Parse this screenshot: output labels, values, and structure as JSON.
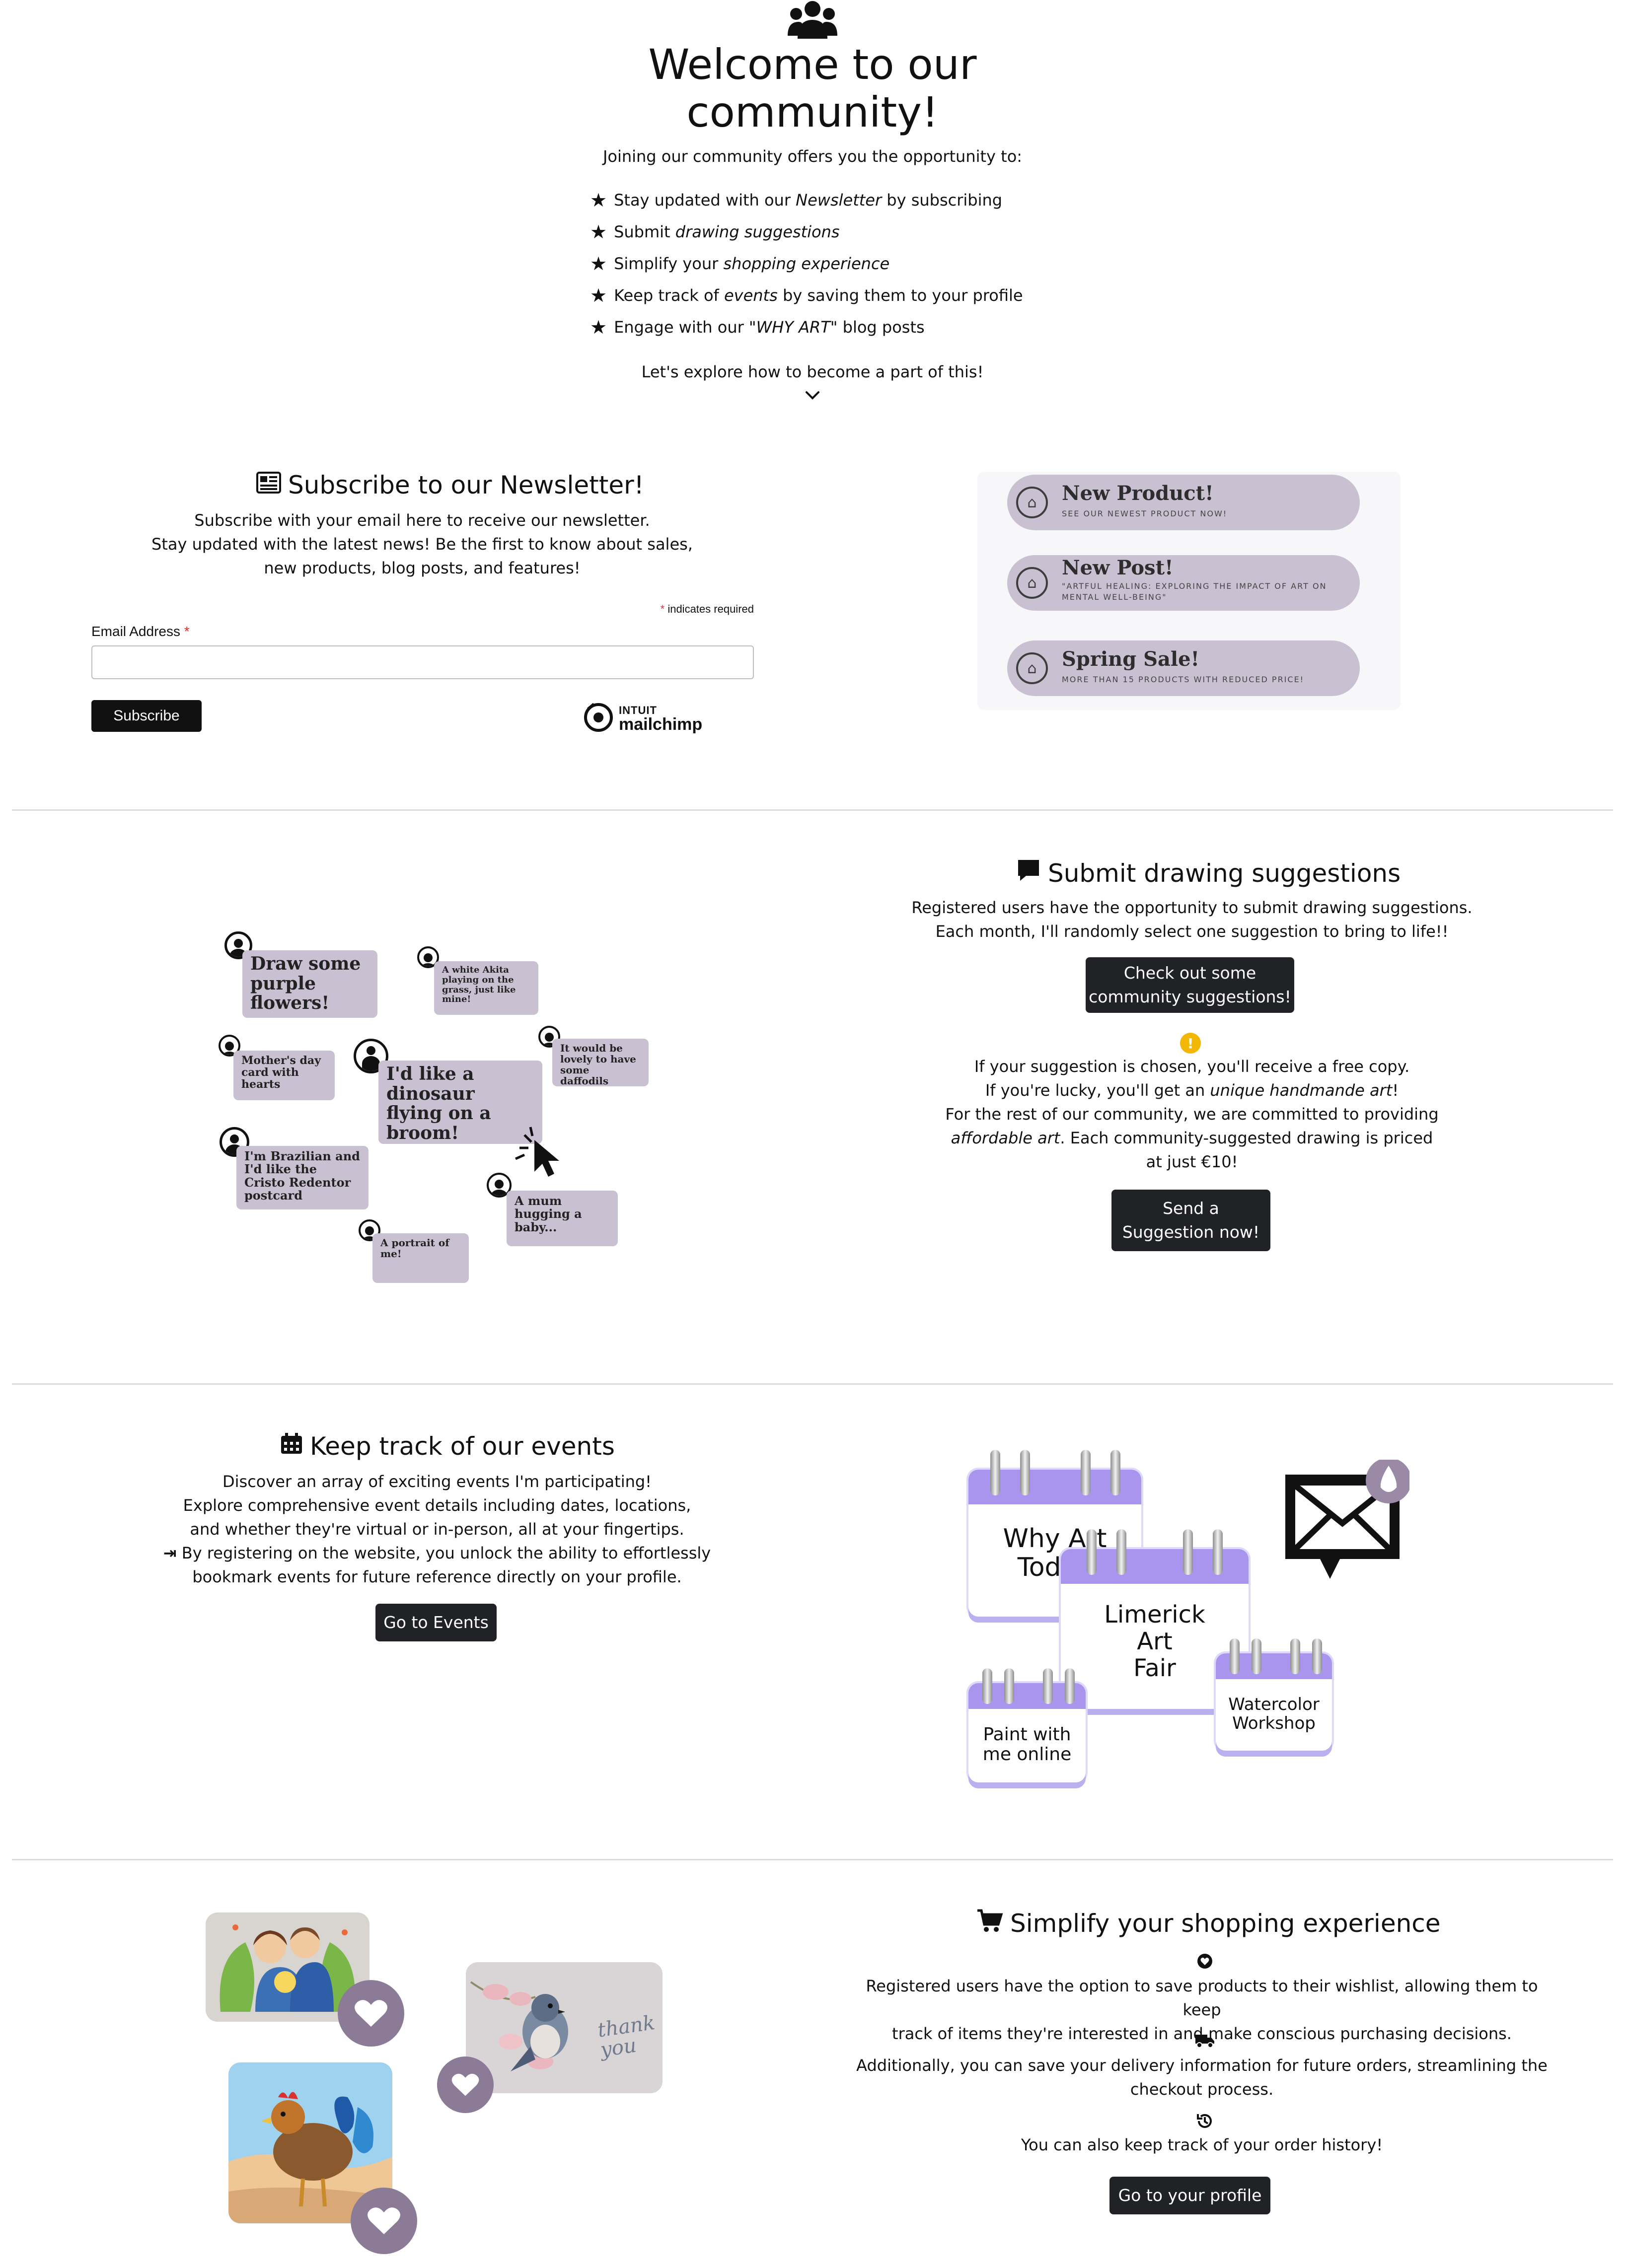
{
  "hero": {
    "icon": "users-icon",
    "title_line1": "Welcome to our",
    "title_line2": "community!",
    "subtitle": "Joining our community offers you the opportunity to:",
    "benefits": [
      {
        "pre": "Stay updated with our ",
        "em": "Newsletter",
        "post": " by subscribing"
      },
      {
        "pre": "Submit ",
        "em": "drawing suggestions",
        "post": ""
      },
      {
        "pre": "Simplify your ",
        "em": "shopping experience",
        "post": ""
      },
      {
        "pre": "Keep track of ",
        "em": "events",
        "post": " by saving them to your profile"
      },
      {
        "pre": "Engage with our ",
        "em": "\"WHY ART\"",
        "post": " blog posts"
      }
    ],
    "explore": "Let's explore how to become a part of this!"
  },
  "newsletter": {
    "title": "Subscribe to our Newsletter!",
    "line1": "Subscribe with your email here to receive our newsletter.",
    "line2": "Stay updated with the latest news! Be the first to know about sales,",
    "line3": "new products, blog posts, and features!",
    "required_note": "indicates required",
    "email_label": "Email Address",
    "subscribe_label": "Subscribe",
    "mailchimp_top": "INTUIT",
    "mailchimp_bottom": "mailchimp",
    "notifications": [
      {
        "title": "New Product!",
        "sub": "SEE OUR NEWEST PRODUCT NOW!"
      },
      {
        "title": "New Post!",
        "sub": "\"ARTFUL HEALING: EXPLORING THE IMPACT OF ART ON MENTAL WELL-BEING\""
      },
      {
        "title": "Spring Sale!",
        "sub": "MORE THAN 15 PRODUCTS WITH REDUCED PRICE!"
      }
    ]
  },
  "suggestions": {
    "title": "Submit drawing suggestions",
    "line1": "Registered users have the opportunity to submit drawing suggestions.",
    "line2": "Each month, I'll randomly select one suggestion to bring to life!!",
    "check_btn_line1": "Check out some",
    "check_btn_line2": "community suggestions!",
    "info1": "If your suggestion is chosen, you'll receive a free copy.",
    "info2_pre": "If you're lucky, you'll get an ",
    "info2_em": "unique handmande art",
    "info2_post": "!",
    "info3": "For the rest of our community, we are committed to providing",
    "info4_em": "affordable art",
    "info4_post": ". Each community-suggested drawing is priced",
    "info5": "at just €10!",
    "send_btn_line1": "Send a",
    "send_btn_line2": "Suggestion now!",
    "bubbles": [
      "Draw some purple flowers!",
      "A white Akita playing on the grass, just like mine!",
      "Mother's day card with hearts",
      "I'd like a dinosaur flying on a broom!",
      "It would be lovely to have some daffodils",
      "I'm Brazilian and I'd like the Cristo Redentor postcard",
      "A mum hugging a baby...",
      "A portrait of me!"
    ]
  },
  "events": {
    "title": "Keep track of our events",
    "line1": "Discover an array of exciting events I'm participating!",
    "line2": "Explore comprehensive event details including dates, locations,",
    "line3": "and whether they're virtual or in-person, all at your fingertips.",
    "line4": "By registering on the website, you unlock the ability to effortlessly",
    "line5": "bookmark events for future reference directly on your profile.",
    "button": "Go to Events",
    "calendars": {
      "why_line1": "Why Art",
      "why_line2": "Today",
      "limerick_line1": "Limerick",
      "limerick_line2": "Art",
      "limerick_line3": "Fair",
      "paint_line1": "Paint with",
      "paint_line2": "me online",
      "water_line1": "Watercolor",
      "water_line2": "Workshop"
    }
  },
  "shopping": {
    "title": "Simplify your shopping experience",
    "line1": "Registered users have the option to save products to their wishlist, allowing them to keep",
    "line2": "track of items they're interested in and make conscious purchasing decisions.",
    "line3": "Additionally, you can save your delivery information for future orders, streamlining the",
    "line4": "checkout process.",
    "line5": "You can also keep track of your order history!",
    "button": "Go to your profile",
    "thank_you": "thank you"
  },
  "colors": {
    "lavender": "#c9c1d1",
    "button_dark": "#202225",
    "heart_purple": "#8b7b97",
    "calendar_purple": "#a994ee",
    "warning_yellow": "#f2b705",
    "required_red": "#e03131"
  }
}
